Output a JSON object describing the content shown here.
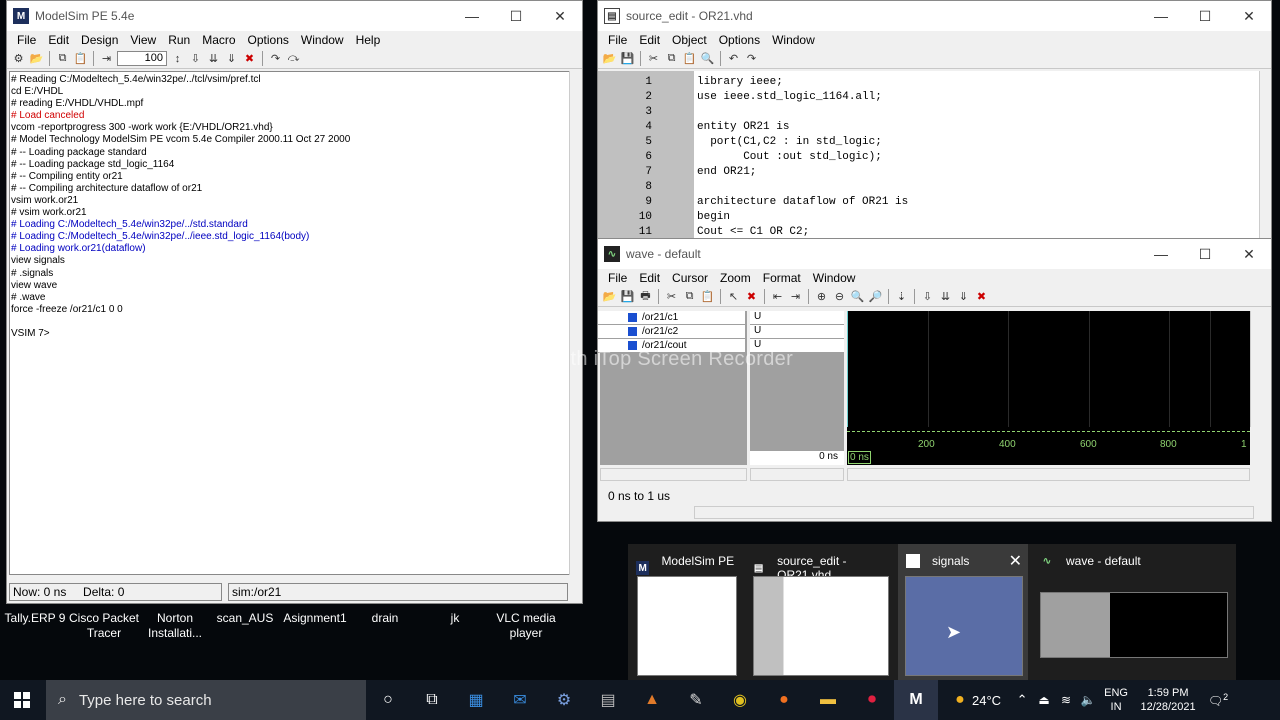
{
  "desktop": {
    "icons": [
      {
        "label": "Tally.ERP 9"
      },
      {
        "label": "Cisco Packet Tracer"
      },
      {
        "label": "Norton Installati..."
      },
      {
        "label": "scan_AUS"
      },
      {
        "label": "Asignment1"
      },
      {
        "label": "drain"
      },
      {
        "label": "jk"
      },
      {
        "label": "VLC media player"
      }
    ],
    "watermark": "Recorded with iTop Screen Recorder"
  },
  "modelsim": {
    "title": "ModelSim PE 5.4e",
    "menu": [
      "File",
      "Edit",
      "Design",
      "View",
      "Run",
      "Macro",
      "Options",
      "Window",
      "Help"
    ],
    "run_length": "100",
    "console_lines": [
      {
        "text": "# Reading C:/Modeltech_5.4e/win32pe/../tcl/vsim/pref.tcl",
        "color": "#000000"
      },
      {
        "text": "cd E:/VHDL",
        "color": "#000000"
      },
      {
        "text": "# reading E:/VHDL/VHDL.mpf",
        "color": "#000000"
      },
      {
        "text": "# Load canceled",
        "color": "#d00000"
      },
      {
        "text": "vcom -reportprogress 300 -work work {E:/VHDL/OR21.vhd}",
        "color": "#000000"
      },
      {
        "text": "# Model Technology ModelSim PE vcom 5.4e Compiler 2000.11 Oct 27 2000",
        "color": "#000000"
      },
      {
        "text": "# -- Loading package standard",
        "color": "#000000"
      },
      {
        "text": "# -- Loading package std_logic_1164",
        "color": "#000000"
      },
      {
        "text": "# -- Compiling entity or21",
        "color": "#000000"
      },
      {
        "text": "# -- Compiling architecture dataflow of or21",
        "color": "#000000"
      },
      {
        "text": "vsim work.or21",
        "color": "#000000"
      },
      {
        "text": "# vsim work.or21",
        "color": "#000000"
      },
      {
        "text": "# Loading C:/Modeltech_5.4e/win32pe/../std.standard",
        "color": "#0000c0"
      },
      {
        "text": "# Loading C:/Modeltech_5.4e/win32pe/../ieee.std_logic_1164(body)",
        "color": "#0000c0"
      },
      {
        "text": "# Loading work.or21(dataflow)",
        "color": "#0000c0"
      },
      {
        "text": "view signals",
        "color": "#000000"
      },
      {
        "text": "# .signals",
        "color": "#000000"
      },
      {
        "text": "view wave",
        "color": "#000000"
      },
      {
        "text": "# .wave",
        "color": "#000000"
      },
      {
        "text": "force -freeze /or21/c1 0 0",
        "color": "#000000"
      },
      {
        "text": "",
        "color": "#000000"
      },
      {
        "text": "VSIM 7>",
        "color": "#000000"
      }
    ],
    "status_now": "Now: 0 ns",
    "status_delta": "Delta: 0",
    "status_sim": "sim:/or21"
  },
  "source_edit": {
    "title": "source_edit - OR21.vhd",
    "menu": [
      "File",
      "Edit",
      "Object",
      "Options",
      "Window"
    ],
    "line_numbers": [
      "1",
      "2",
      "3",
      "4",
      "5",
      "6",
      "7",
      "8",
      "9",
      "10",
      "11"
    ],
    "code_lines": [
      "library ieee;",
      "use ieee.std_logic_1164.all;",
      "",
      "entity OR21 is",
      "  port(C1,C2 : in std_logic;",
      "       Cout :out std_logic);",
      "end OR21;",
      "",
      "architecture dataflow of OR21 is",
      "begin",
      "Cout <= C1 OR C2;"
    ]
  },
  "wave": {
    "title": "wave - default",
    "menu": [
      "File",
      "Edit",
      "Cursor",
      "Zoom",
      "Format",
      "Window"
    ],
    "signals": [
      {
        "name": "/or21/c1",
        "value": "U"
      },
      {
        "name": "/or21/c2",
        "value": "U"
      },
      {
        "name": "/or21/cout",
        "value": "U"
      }
    ],
    "cursor_time": "0 ns",
    "cursor_label": "0 ns",
    "time_ticks": [
      "200",
      "400",
      "600",
      "800",
      "1"
    ],
    "range_status": "0 ns to 1 us"
  },
  "thumbnails": [
    {
      "title": "ModelSim PE ..."
    },
    {
      "title": "source_edit - OR21.vhd"
    },
    {
      "title": "signals"
    },
    {
      "title": "wave - default"
    }
  ],
  "taskbar": {
    "search_placeholder": "Type here to search",
    "weather": "24°C",
    "lang_line1": "ENG",
    "lang_line2": "IN",
    "time": "1:59 PM",
    "date": "12/28/2021",
    "notification_count": "2"
  },
  "colors": {
    "waveform_bg": "#000000",
    "timeline_ticks": "#8fd36f",
    "signal_marker": "#1a4fd0",
    "taskbar_bg": "#101721"
  }
}
